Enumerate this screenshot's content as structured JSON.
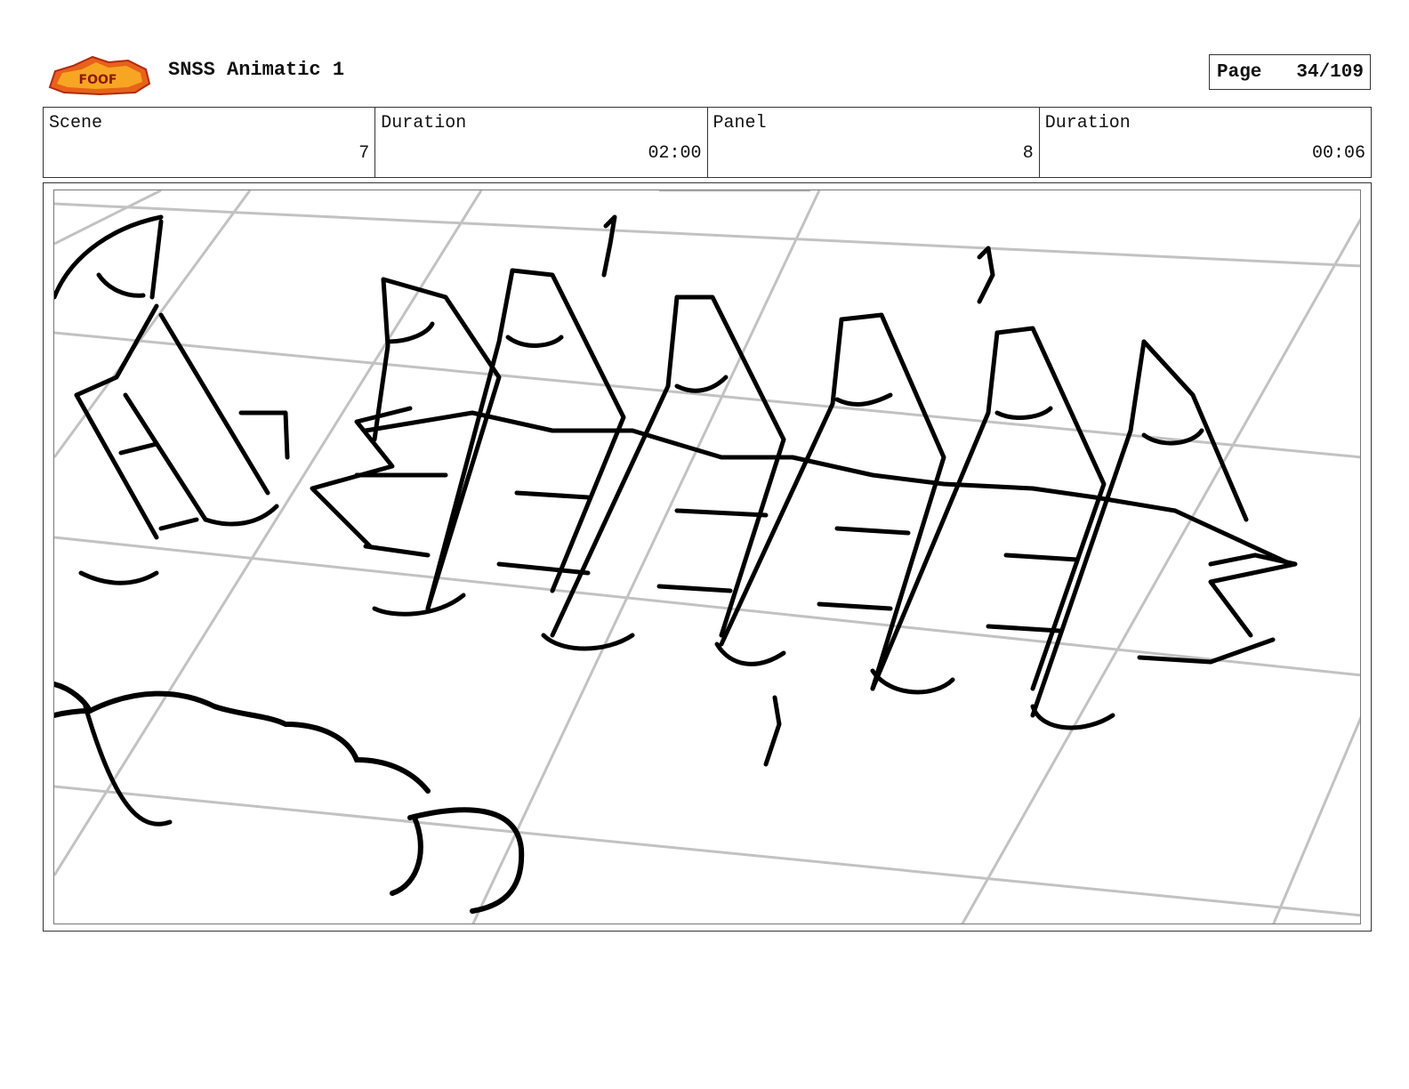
{
  "header": {
    "logo_label": "Sir Foof-So-Lot",
    "title": "SNSS Animatic 1",
    "page_label": "Page",
    "page_value": "34/109"
  },
  "info": [
    {
      "label": "Scene",
      "value": "7"
    },
    {
      "label": "Duration",
      "value": "02:00"
    },
    {
      "label": "Panel",
      "value": "8"
    },
    {
      "label": "Duration",
      "value": "00:06"
    }
  ],
  "panel": {
    "description": "",
    "colors": {
      "grid": "#c2c2c2",
      "ink": "#000000"
    }
  }
}
